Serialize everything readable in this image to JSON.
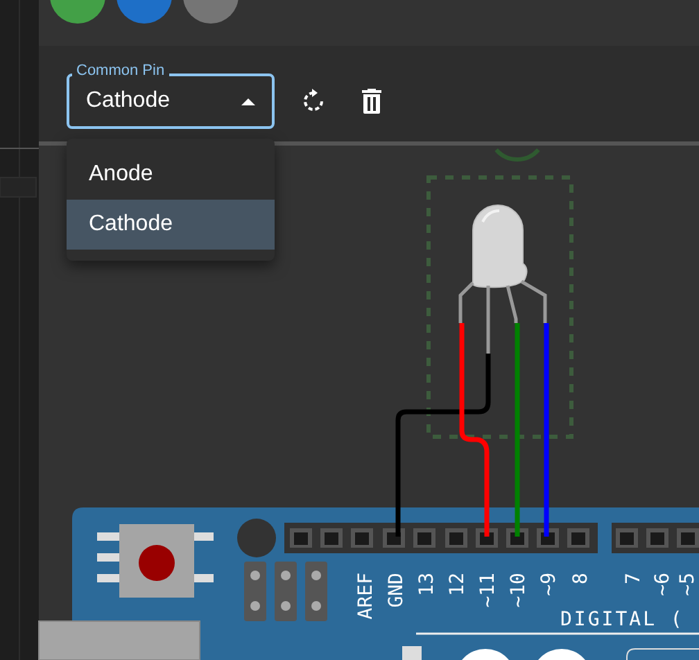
{
  "field": {
    "label": "Common Pin",
    "value": "Cathode",
    "expanded": true
  },
  "options": [
    {
      "label": "Anode",
      "selected": false
    },
    {
      "label": "Cathode",
      "selected": true
    }
  ],
  "board": {
    "pin_labels": [
      "AREF",
      "GND",
      "13",
      "12",
      "~11",
      "~10",
      "~9",
      "8",
      "7",
      "~6",
      "~5"
    ],
    "section_label": "DIGITAL ("
  },
  "wires": [
    {
      "color": "#000000"
    },
    {
      "color": "#ff0000"
    },
    {
      "color": "#008000"
    },
    {
      "color": "#0000ff"
    }
  ]
}
